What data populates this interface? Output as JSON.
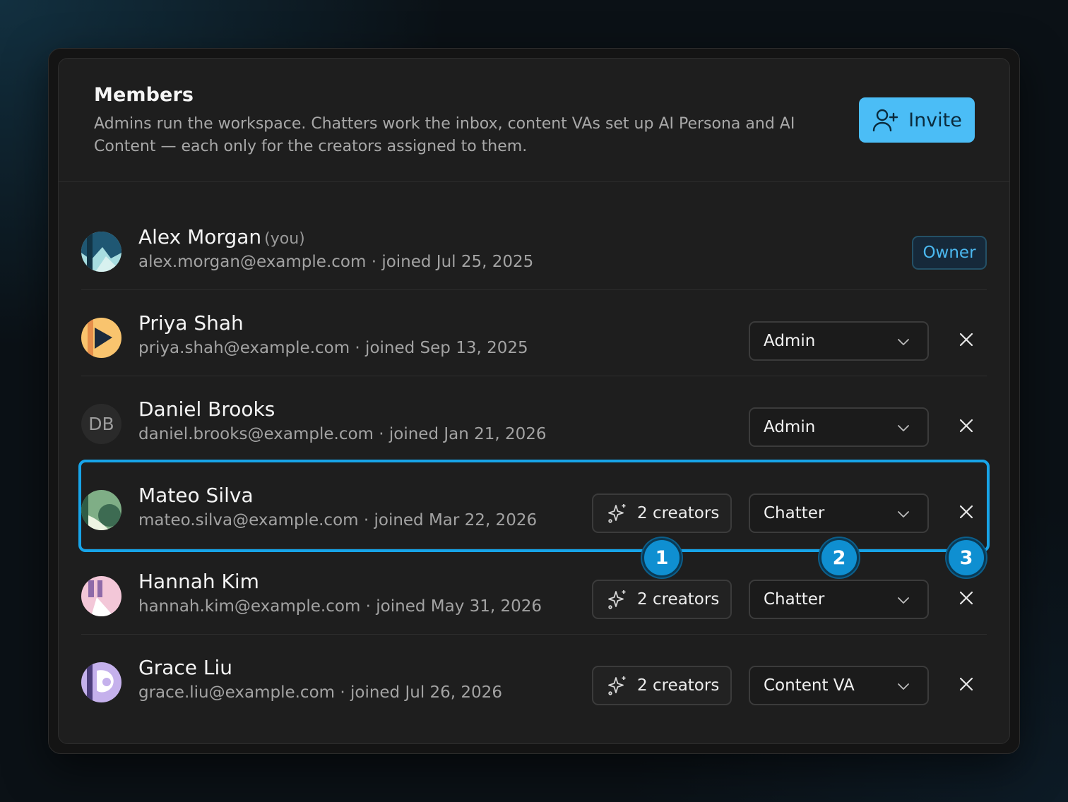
{
  "header": {
    "title": "Members",
    "description": "Admins run the workspace. Chatters work the inbox, content VAs set up AI Persona and AI Content — each only for the creators assigned to them.",
    "invite_label": "Invite"
  },
  "members": [
    {
      "name": "Alex Morgan",
      "you_label": "(you)",
      "meta": "alex.morgan@example.com · joined Jul 25, 2025",
      "badge": "Owner"
    },
    {
      "name": "Priya Shah",
      "meta": "priya.shah@example.com · joined Sep 13, 2025",
      "role": "Admin"
    },
    {
      "name": "Daniel Brooks",
      "initials": "DB",
      "meta": "daniel.brooks@example.com · joined Jan 21, 2026",
      "role": "Admin"
    },
    {
      "name": "Mateo Silva",
      "meta": "mateo.silva@example.com · joined Mar 22, 2026",
      "role": "Chatter",
      "creators": "2 creators"
    },
    {
      "name": "Hannah Kim",
      "meta": "hannah.kim@example.com · joined May 31, 2026",
      "role": "Chatter",
      "creators": "2 creators"
    },
    {
      "name": "Grace Liu",
      "meta": "grace.liu@example.com · joined Jul 26, 2026",
      "role": "Content VA",
      "creators": "2 creators"
    }
  ],
  "markers": [
    "1",
    "2",
    "3"
  ],
  "colors": {
    "accent": "#4bbdf6",
    "highlight": "#17a4e8",
    "card_bg": "#1e1e1e"
  }
}
